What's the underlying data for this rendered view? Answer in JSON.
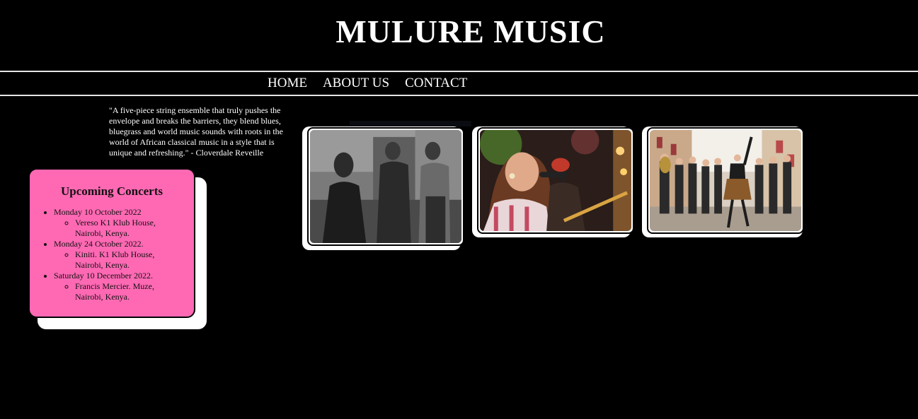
{
  "header": {
    "title": "MULURE MUSIC"
  },
  "nav": {
    "items": [
      {
        "label": "HOME"
      },
      {
        "label": "ABOUT US"
      },
      {
        "label": "CONTACT"
      }
    ]
  },
  "quote": {
    "text": "\"A five-piece string ensemble that truly pushes the envelope and breaks the barriers, they blend blues, bluegrass and world music sounds with roots in the world of African classical music in a style that is unique and refreshing.\" - Cloverdale Reveille"
  },
  "concerts": {
    "title": "Upcoming Concerts",
    "items": [
      {
        "date": "Monday 10 October 2022",
        "detail": "Vereso K1 Klub House, Nairobi, Kenya."
      },
      {
        "date": "Monday 24 October 2022.",
        "detail": "Kiniti. K1 Klub House, Nairobi, Kenya."
      },
      {
        "date": "Saturday 10 December 2022.",
        "detail": "Francis Mercier. Muze, Nairobi, Kenya."
      }
    ]
  },
  "colors": {
    "background": "#000000",
    "concerts_card": "#ff69b4",
    "card_shadow": "#ffffff"
  }
}
